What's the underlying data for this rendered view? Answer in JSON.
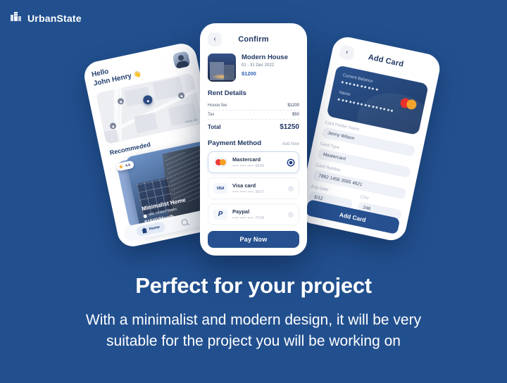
{
  "brand": {
    "name": "UrbanState",
    "icon": "building-icon"
  },
  "hero": {
    "title": "Perfect for your project",
    "subtitle_line1": "With a minimalist and modern design, it will be very",
    "subtitle_line2": "suitable for the project you will be working on"
  },
  "colors": {
    "background": "#22508f",
    "primary": "#26508f",
    "accent_link": "#2f62b5",
    "heading": "#1f3763",
    "muted": "#9aa3b5"
  },
  "home_screen": {
    "greeting_line1": "Hello",
    "greeting_line2": "John Henry",
    "wave_emoji": "👋",
    "avatar": "user-avatar",
    "map_view_all": "View all",
    "recommended_title": "Recommeded",
    "listing": {
      "rating": "4.9",
      "name": "Minimalist Home",
      "location": "WA, United States",
      "price": "$1500/Month"
    },
    "tabs": [
      {
        "label": "Home",
        "icon": "home-icon",
        "active": true
      },
      {
        "label": "",
        "icon": "search-icon",
        "active": false
      },
      {
        "label": "",
        "icon": "message-icon",
        "active": false
      }
    ]
  },
  "confirm_screen": {
    "back": "‹",
    "title": "Confirm",
    "property": {
      "name": "Modern House",
      "dates": "01 - 31 Dec 2022",
      "price": "$1200"
    },
    "rent_details": {
      "title": "Rent Details",
      "rows": [
        {
          "label": "House fee",
          "value": "$1200"
        },
        {
          "label": "Tax",
          "value": "$50"
        }
      ],
      "total_label": "Total",
      "total_value": "$1250"
    },
    "payment_method": {
      "title": "Payment Method",
      "add_new": "Add New",
      "options": [
        {
          "name": "Mastercard",
          "mask": "•••• •••• •••• 4586",
          "logo": "mastercard-logo",
          "selected": true
        },
        {
          "name": "Visa card",
          "mask": "•••• •••• •••• 3927",
          "logo": "visa-logo",
          "selected": false
        },
        {
          "name": "Paypal",
          "mask": "•••• •••• •••• 7036",
          "logo": "paypal-logo",
          "selected": false
        }
      ]
    },
    "pay_button": "Pay Now"
  },
  "add_card_screen": {
    "back": "‹",
    "title": "Add Card",
    "card": {
      "balance_label": "Current Balance",
      "balance_masked": "••••••••••",
      "name_label": "Name",
      "name_masked": "•••••••••••••••",
      "brand_logo": "mastercard-logo"
    },
    "fields": [
      {
        "label": "Card Holder Name",
        "value": "Jenny Wilson"
      },
      {
        "label": "Card Type",
        "value": "Mastercard"
      },
      {
        "label": "Card Number",
        "value": "7862 1456 3585 4621"
      }
    ],
    "expiry": {
      "label": "Exp Date",
      "value": "5/12"
    },
    "cvv": {
      "label": "CVV",
      "value": "246"
    },
    "submit_button": "Add Card"
  }
}
